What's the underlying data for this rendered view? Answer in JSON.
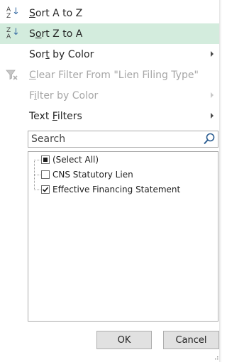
{
  "menu": {
    "sort_a_z": {
      "label": "Sort A to Z",
      "icon": "sort-ascending-icon"
    },
    "sort_z_a": {
      "label": "Sort Z to A",
      "icon": "sort-descending-icon"
    },
    "sort_by_color": {
      "label": "Sort by Color"
    },
    "clear_filter": {
      "label": "Clear Filter From \"Lien Filing Type\"",
      "icon": "clear-filter-icon"
    },
    "filter_by_color": {
      "label": "Filter by Color"
    },
    "text_filters": {
      "label": "Text Filters"
    }
  },
  "search": {
    "placeholder": "Search",
    "icon": "search-icon"
  },
  "list": {
    "items": [
      {
        "label": "(Select All)",
        "state": "partial"
      },
      {
        "label": "CNS Statutory Lien",
        "state": "unchecked"
      },
      {
        "label": "Effective Financing Statement",
        "state": "checked"
      }
    ]
  },
  "buttons": {
    "ok": "OK",
    "cancel": "Cancel"
  },
  "colors": {
    "highlight": "#d3ecdd",
    "disabled_text": "#a6a6a6",
    "accent_icon": "#3a6ea5"
  }
}
